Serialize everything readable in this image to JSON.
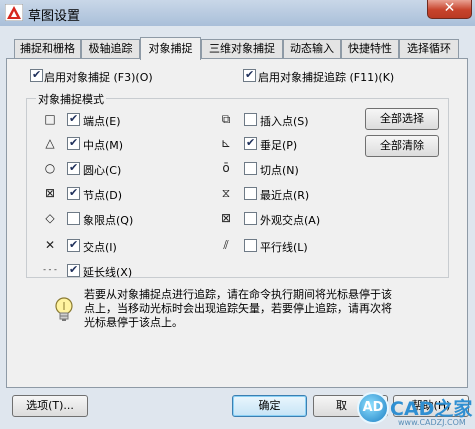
{
  "window": {
    "title": "草图设置",
    "close_symbol": "✕"
  },
  "tabs": [
    {
      "label": "捕捉和栅格",
      "active": false
    },
    {
      "label": "极轴追踪",
      "active": false
    },
    {
      "label": "对象捕捉",
      "active": true
    },
    {
      "label": "三维对象捕捉",
      "active": false
    },
    {
      "label": "动态输入",
      "active": false
    },
    {
      "label": "快捷特性",
      "active": false
    },
    {
      "label": "选择循环",
      "active": false
    }
  ],
  "snap": {
    "enable_osnap": {
      "label": "启用对象捕捉 (F3)(O)",
      "checked": true
    },
    "enable_tracking": {
      "label": "启用对象捕捉追踪 (F11)(K)",
      "checked": true
    },
    "group_title": "对象捕捉模式",
    "left_modes": [
      {
        "symbol": "□",
        "label": "端点(E)",
        "checked": true
      },
      {
        "symbol": "△",
        "label": "中点(M)",
        "checked": true
      },
      {
        "symbol": "○",
        "label": "圆心(C)",
        "checked": true
      },
      {
        "symbol": "⊠",
        "label": "节点(D)",
        "checked": true
      },
      {
        "symbol": "◇",
        "label": "象限点(Q)",
        "checked": false
      },
      {
        "symbol": "✕",
        "label": "交点(I)",
        "checked": true
      },
      {
        "symbol": "- - -",
        "label": "延长线(X)",
        "checked": true
      }
    ],
    "right_modes": [
      {
        "symbol": "⧉",
        "label": "插入点(S)",
        "checked": false
      },
      {
        "symbol": "⊾",
        "label": "垂足(P)",
        "checked": true
      },
      {
        "symbol": "ō",
        "label": "切点(N)",
        "checked": false
      },
      {
        "symbol": "⧖",
        "label": "最近点(R)",
        "checked": false
      },
      {
        "symbol": "⊠",
        "label": "外观交点(A)",
        "checked": false
      },
      {
        "symbol": "⫽",
        "label": "平行线(L)",
        "checked": false
      }
    ],
    "select_all": "全部选择",
    "clear_all": "全部清除",
    "info_text": "若要从对象捕捉点进行追踪，请在命令执行期间将光标悬停于该点上，当移动光标时会出现追踪矢量，若要停止追踪，请再次将光标悬停于该点上。"
  },
  "footer": {
    "options": "选项(T)...",
    "ok": "确定",
    "cancel": "取",
    "help": "帮助(H)"
  },
  "watermark": {
    "icon": "AD",
    "text": "CAD之家",
    "url": "www.CADZJ.COM"
  },
  "colors": {
    "accent": "#3c7fb1",
    "close": "#c7432c",
    "watermark": "#2f8fd2"
  }
}
